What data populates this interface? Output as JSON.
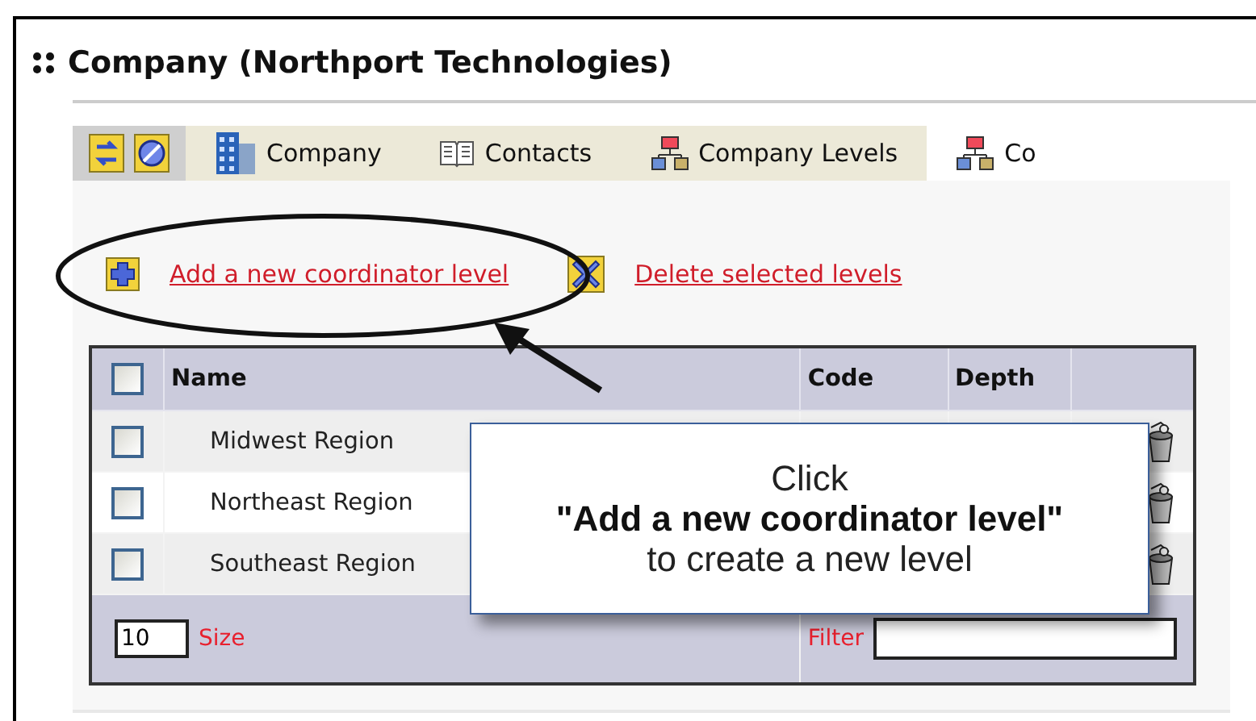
{
  "title": "Company (Northport Technologies)",
  "tabs": [
    {
      "label": "Company",
      "kind": "building",
      "selected": false
    },
    {
      "label": "Contacts",
      "kind": "book",
      "selected": false
    },
    {
      "label": "Company Levels",
      "kind": "hierarchy",
      "selected": false
    },
    {
      "label": "Co",
      "kind": "hierarchy",
      "selected": true
    }
  ],
  "actions": [
    {
      "label": "Add a new coordinator level",
      "kind": "add"
    },
    {
      "label": "Delete selected levels",
      "kind": "delete"
    }
  ],
  "table": {
    "columns": [
      "Name",
      "Code",
      "Depth"
    ],
    "all_checked": false,
    "rows": [
      {
        "name": "Midwest Region",
        "checked": false
      },
      {
        "name": "Northeast Region",
        "checked": false
      },
      {
        "name": "Southeast Region",
        "checked": false
      }
    ],
    "page_size": "10",
    "size_label": "Size",
    "filter_label": "Filter"
  },
  "callout": [
    {
      "text": "Click",
      "bold": false
    },
    {
      "text": "\"Add a new coordinator level\"",
      "bold": true
    },
    {
      "text": "to create a new level",
      "bold": false
    }
  ]
}
